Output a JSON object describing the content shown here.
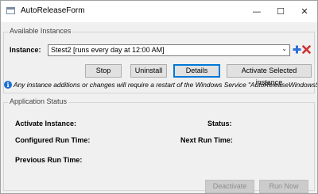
{
  "window": {
    "title": "AutoReleaseForm",
    "minimize": "—",
    "maximize": "☐",
    "close": "✕"
  },
  "instances_group": {
    "legend": "Available Instances",
    "instance_label": "Instance:",
    "selected_instance": "Stest2 [runs every day at 12:00 AM]",
    "buttons": {
      "stop": "Stop",
      "uninstall": "Uninstall",
      "details": "Details",
      "activate_selected": "Activate Selected instance"
    },
    "info_message": "Any instance additions or changes will require a restart of the Windows Service \"AutoReleaseWindowsService\"."
  },
  "status_group": {
    "legend": "Application Status",
    "activate_instance_label": "Activate Instance:",
    "status_label": "Status:",
    "configured_run_time_label": "Configured Run Time:",
    "next_run_time_label": "Next Run Time:",
    "previous_run_time_label": "Previous Run Time:",
    "buttons": {
      "deactivate": "Deactivate",
      "run_now": "Run Now"
    }
  },
  "colors": {
    "plus_icon": "#2e6fd6",
    "x_icon": "#d03030",
    "info_icon": "#1c6fd0",
    "focus_border": "#0078d7"
  }
}
